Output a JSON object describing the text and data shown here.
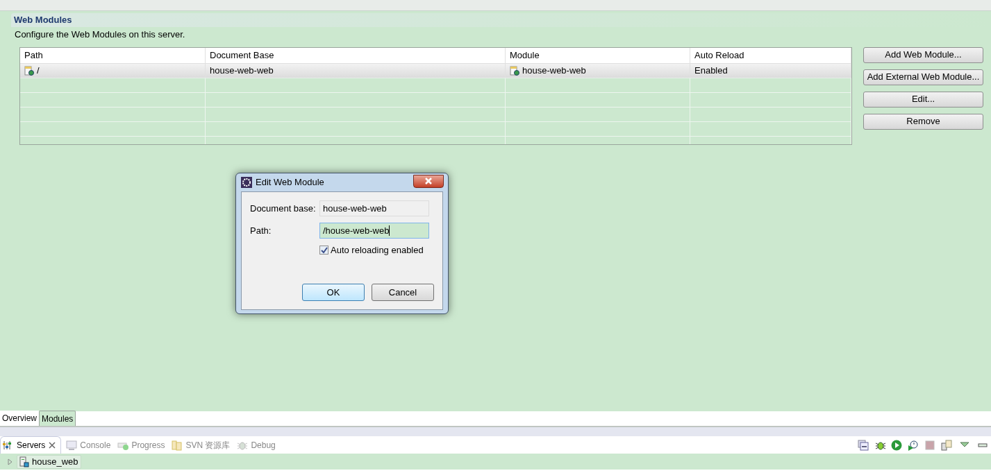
{
  "section": {
    "title": "Web Modules",
    "description": "Configure the Web Modules on this server."
  },
  "table": {
    "columns": [
      "Path",
      "Document Base",
      "Module",
      "Auto Reload"
    ],
    "rows": [
      {
        "path": "/",
        "document_base": "house-web-web",
        "module": "house-web-web",
        "auto_reload": "Enabled",
        "selected": true
      }
    ]
  },
  "buttons": [
    "Add Web Module...",
    "Add External Web Module...",
    "Edit...",
    "Remove"
  ],
  "dialog": {
    "title": "Edit Web Module",
    "document_base_label": "Document base:",
    "document_base": "house-web-web",
    "path_label": "Path:",
    "path": "/house-web-web",
    "auto_reload": {
      "label": "Auto reloading enabled",
      "checked": true
    },
    "buttons": [
      {
        "label": "OK",
        "default": true
      },
      {
        "label": "Cancel",
        "default": false
      }
    ]
  },
  "editor_tabs": [
    {
      "label": "Overview",
      "selected": false
    },
    {
      "label": "Modules",
      "selected": true
    }
  ],
  "view_tabs": [
    {
      "label": "Servers",
      "selected": true
    },
    {
      "label": "Console",
      "selected": false
    },
    {
      "label": "Progress",
      "selected": false
    },
    {
      "label": "SVN 资源库",
      "selected": false
    },
    {
      "label": "Debug",
      "selected": false
    }
  ],
  "servers": [
    {
      "name": "house_web",
      "expanded": false
    }
  ]
}
